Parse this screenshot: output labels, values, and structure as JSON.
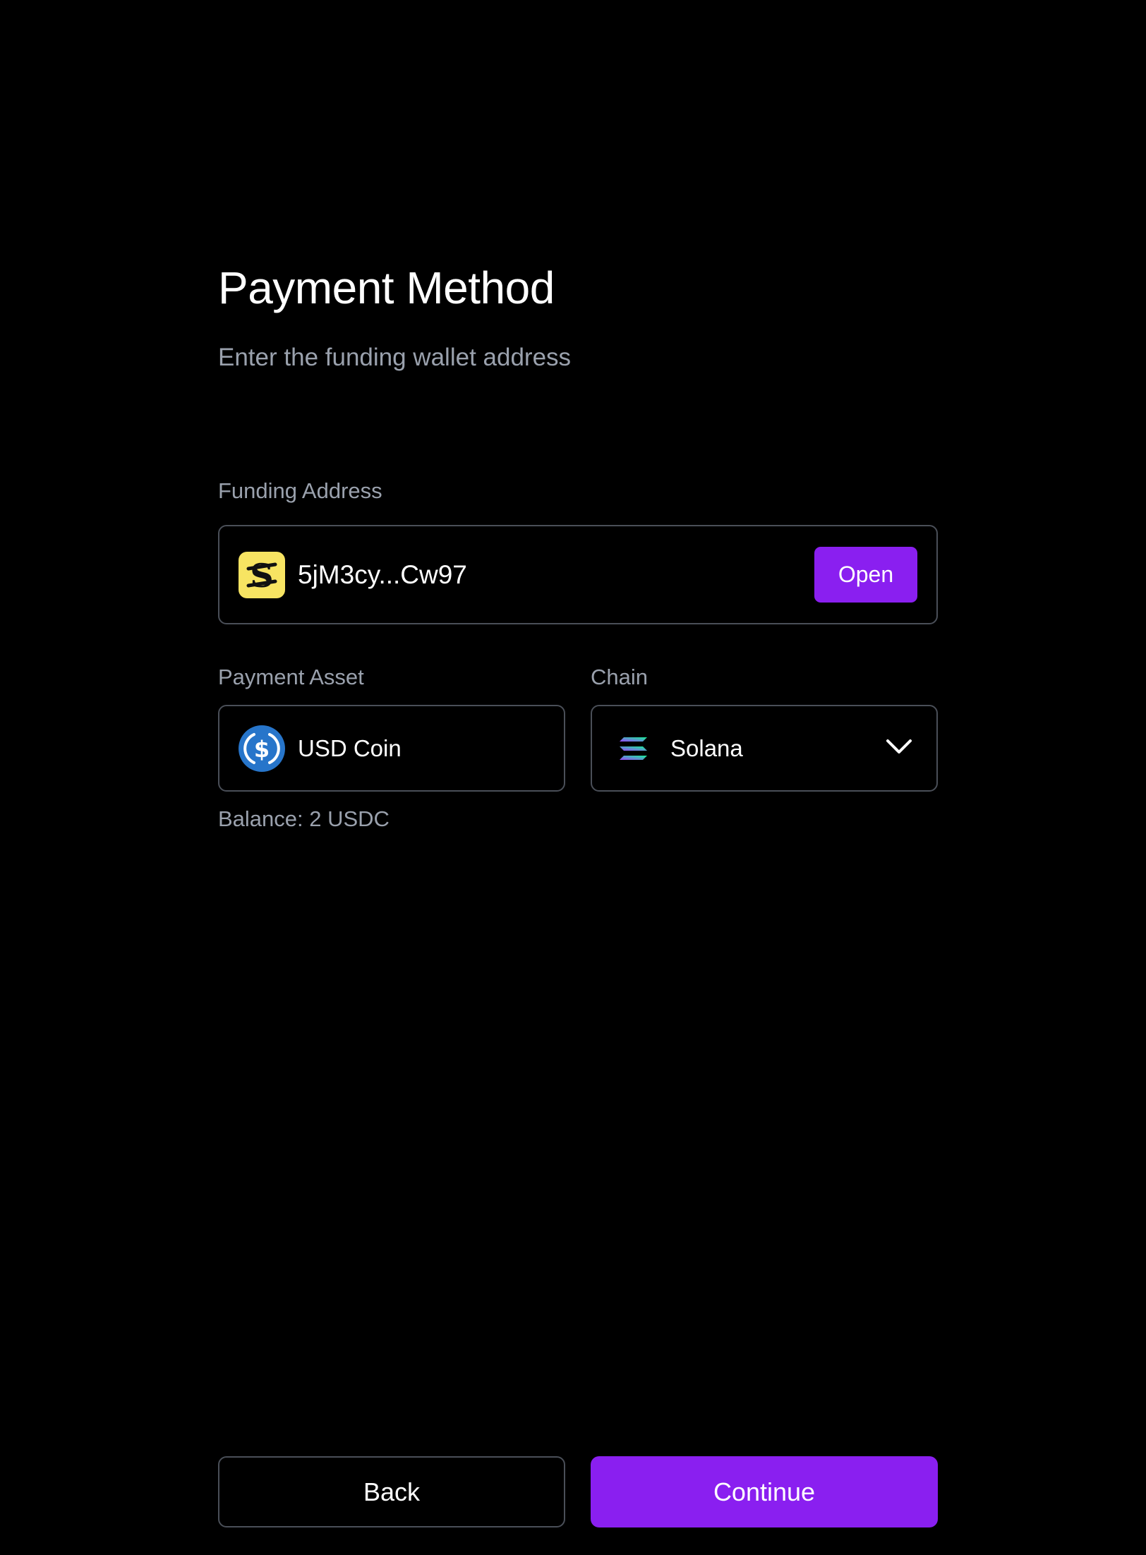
{
  "header": {
    "title": "Payment Method",
    "subtitle": "Enter the funding wallet address"
  },
  "funding": {
    "label": "Funding Address",
    "wallet_icon": "stablecoin-s-icon",
    "address": "5jM3cy...Cw97",
    "open_label": "Open"
  },
  "asset": {
    "label": "Payment Asset",
    "icon": "usdc-icon",
    "value": "USD Coin",
    "balance": "Balance: 2 USDC"
  },
  "chain": {
    "label": "Chain",
    "icon": "solana-icon",
    "value": "Solana",
    "dropdown_icon": "chevron-down-icon"
  },
  "footer": {
    "back_label": "Back",
    "continue_label": "Continue"
  },
  "colors": {
    "background": "#000000",
    "accent": "#8a1ff0",
    "muted_text": "#9aa1ad",
    "border": "#4a4f58",
    "wallet_tile": "#f7e462",
    "usdc_blue": "#2775ca"
  }
}
